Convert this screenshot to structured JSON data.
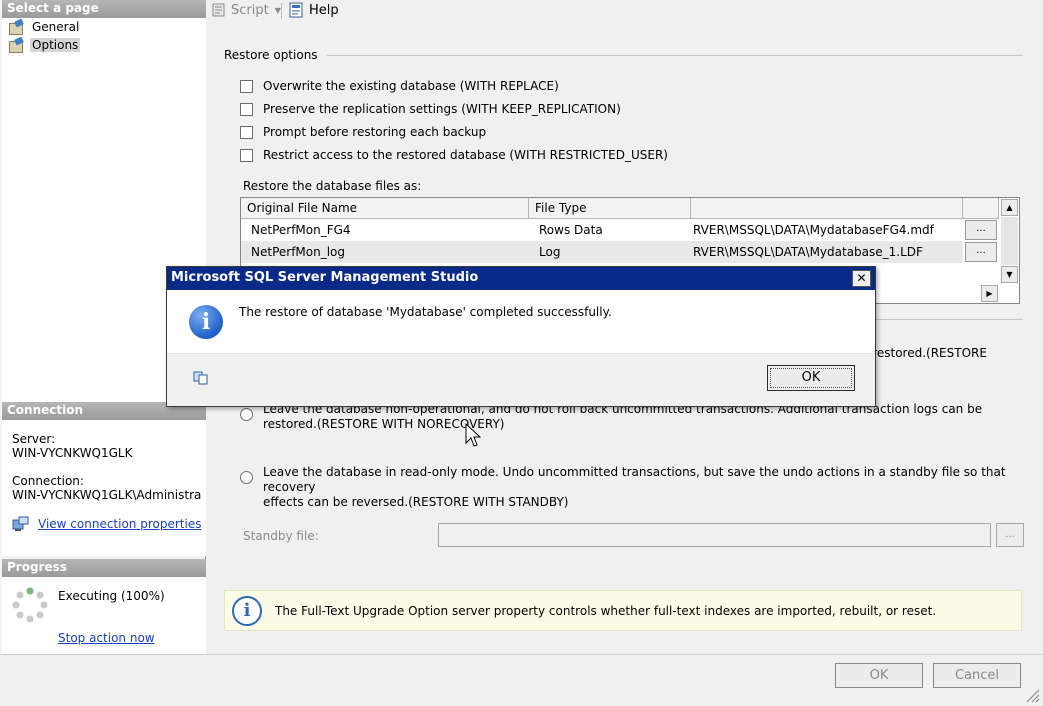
{
  "sidebar": {
    "header": "Select a page",
    "pages": [
      {
        "label": "General",
        "selected": false
      },
      {
        "label": "Options",
        "selected": true
      }
    ],
    "connection": {
      "header": "Connection",
      "server_label": "Server:",
      "server_value": "WIN-VYCNKWQ1GLK",
      "connection_label": "Connection:",
      "connection_value": "WIN-VYCNKWQ1GLK\\Administra",
      "view_properties_link": "View connection properties"
    },
    "progress": {
      "header": "Progress",
      "status": "Executing (100%)",
      "stop_link": "Stop action now"
    }
  },
  "toolbar": {
    "script_label": "Script",
    "help_label": "Help"
  },
  "restore_options": {
    "title": "Restore options",
    "checkboxes": [
      {
        "label": "Overwrite the existing database (WITH REPLACE)",
        "checked": false
      },
      {
        "label": "Preserve the replication settings (WITH KEEP_REPLICATION)",
        "checked": false
      },
      {
        "label": "Prompt before restoring each backup",
        "checked": false
      },
      {
        "label": "Restrict access to the restored database (WITH RESTRICTED_USER)",
        "checked": false
      }
    ],
    "files_label": "Restore the database files as:",
    "grid": {
      "columns": [
        "Original File Name",
        "File Type",
        ""
      ],
      "rows": [
        {
          "name": "NetPerfMon_FG4",
          "type": "Rows Data",
          "path": "RVER\\MSSQL\\DATA\\MydatabaseFG4.mdf",
          "browse": "..."
        },
        {
          "name": "NetPerfMon_log",
          "type": "Log",
          "path": "RVER\\MSSQL\\DATA\\Mydatabase_1.LDF",
          "browse": "..."
        }
      ]
    }
  },
  "recovery": {
    "partial_text": "e restored.(RESTORE",
    "options": [
      {
        "line1": "Leave the database non-operational, and do not roll back uncommitted transactions. Additional transaction logs can be",
        "line2": "restored.(RESTORE WITH NORECOVERY)"
      },
      {
        "line1": "Leave the database in read-only mode. Undo uncommitted transactions, but save the undo actions in a standby file so that recovery",
        "line2": "effects can be reversed.(RESTORE WITH STANDBY)"
      }
    ],
    "standby_label": "Standby file:",
    "standby_value": "",
    "standby_browse": "..."
  },
  "info_bar": {
    "text": "The Full-Text Upgrade Option server property controls whether full-text indexes are imported, rebuilt, or reset."
  },
  "footer": {
    "ok_label": "OK",
    "cancel_label": "Cancel"
  },
  "dialog": {
    "title": "Microsoft SQL Server Management Studio",
    "close": "✕",
    "message": "The restore of database 'Mydatabase' completed successfully.",
    "ok_label": "OK"
  },
  "colors": {
    "dialog_titlebar": "#0a2a88",
    "link": "#1a3fbf",
    "info_bar_bg": "#fbfbe6",
    "section_header": "#9a9a9a"
  }
}
